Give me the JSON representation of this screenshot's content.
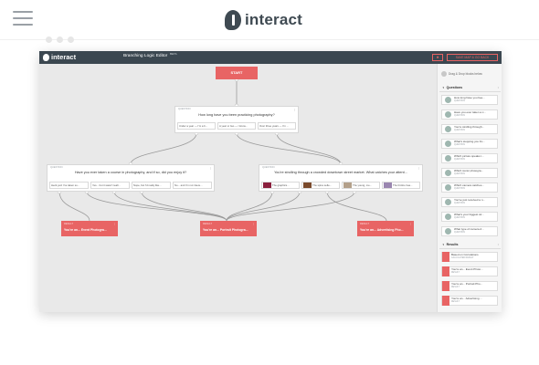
{
  "site": {
    "brand": "interact",
    "menu_icon": "hamburger-icon"
  },
  "app": {
    "logo_text": "interact",
    "editor_title": "Branching Logic Editor",
    "beta": "BETA",
    "close_label": "✖",
    "save_label": "SAVE MAP & GO BACK"
  },
  "canvas": {
    "start_label": "START",
    "q1": {
      "tag": "QUESTION",
      "text": "How long have you been practicing photography?",
      "options": [
        "Under a year — I'm a b...",
        "A year or two — I know...",
        "Over three years — I'm ..."
      ]
    },
    "q2": {
      "tag": "QUESTION",
      "text": "Have you ever taken a course in photography, and if so, did you enjoy it?",
      "options": [
        "Heck yes! I've taken so...",
        "Yes... but it wasn't reall...",
        "Nope, but I'd really like...",
        "No... and I'm not intere..."
      ]
    },
    "q3": {
      "tag": "QUESTION",
      "text": "You're strolling through a crowded downtown street market. What catches your attent...",
      "options": [
        "The graphics...",
        "The spice selle...",
        "The young, me...",
        "The bricks crea..."
      ]
    },
    "results": [
      {
        "tag": "RESULT",
        "text": "You're an... Event Photogra..."
      },
      {
        "tag": "RESULT",
        "text": "You're an... Portrait Photogra..."
      },
      {
        "tag": "RESULT",
        "text": "You're an... Advertising Pho..."
      }
    ],
    "menu_glyph": "⋮"
  },
  "sidebar": {
    "hint": "Drag & Drop blocks below",
    "questions_title": "Questions",
    "results_title": "Results",
    "toggle": "↕",
    "questions": [
      {
        "title": "How long have you bee...",
        "sub": "QUESTION"
      },
      {
        "title": "Have you ever taken a c...",
        "sub": "QUESTION"
      },
      {
        "title": "You're strolling through...",
        "sub": "QUESTION"
      },
      {
        "title": "What's stopping you fro...",
        "sub": "QUESTION"
      },
      {
        "title": "Which picture speaks t...",
        "sub": "QUESTION"
      },
      {
        "title": "Which iconic photogra...",
        "sub": "QUESTION"
      },
      {
        "title": "Which camera catches...",
        "sub": "QUESTION"
      },
      {
        "title": "You've just received a n...",
        "sub": "QUESTION"
      },
      {
        "title": "What's your biggest str...",
        "sub": "QUESTION"
      },
      {
        "title": "What type of camera d...",
        "sub": "QUESTION"
      }
    ],
    "results": [
      {
        "title": "Based on Correlations",
        "sub": "CALCULATED RESULT"
      },
      {
        "title": "You're an... Event Photo...",
        "sub": "RESULT"
      },
      {
        "title": "You're an... Portrait Pho...",
        "sub": "RESULT"
      },
      {
        "title": "You're an... Advertising ...",
        "sub": "RESULT"
      }
    ]
  },
  "colors": {
    "accent": "#e86464",
    "header": "#3b4750",
    "canvas": "#e9e9e9"
  }
}
